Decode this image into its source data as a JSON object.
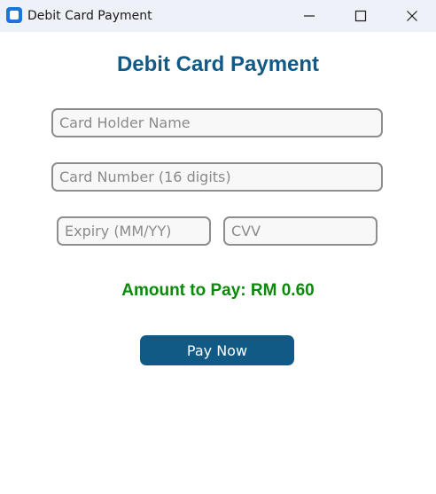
{
  "window": {
    "title": "Debit Card Payment"
  },
  "form": {
    "heading": "Debit Card Payment",
    "card_holder_placeholder": "Card Holder Name",
    "card_number_placeholder": "Card Number (16 digits)",
    "expiry_placeholder": "Expiry (MM/YY)",
    "cvv_placeholder": "CVV",
    "amount_text": "Amount to Pay: RM 0.60",
    "pay_button_label": "Pay Now"
  },
  "colors": {
    "heading": "#125a86",
    "amount": "#0a8a0a",
    "button": "#125a86",
    "titlebar": "#eef2f8"
  },
  "icons": {
    "app": "app-icon",
    "minimize": "minimize-icon",
    "maximize": "maximize-icon",
    "close": "close-icon"
  }
}
